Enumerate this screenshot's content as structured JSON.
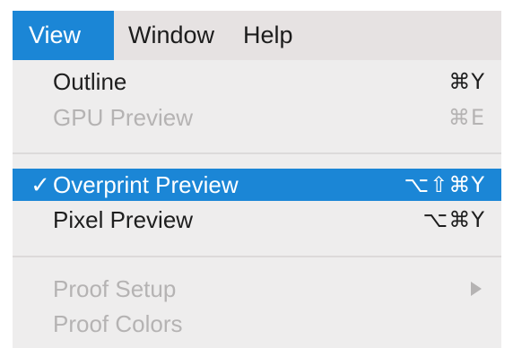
{
  "menubar": {
    "items": [
      {
        "label": "View"
      },
      {
        "label": "Window"
      },
      {
        "label": "Help"
      }
    ]
  },
  "menu": {
    "items": [
      {
        "label": "Outline",
        "shortcut": "⌘Y",
        "enabled": true
      },
      {
        "label": "GPU Preview",
        "shortcut": "⌘E",
        "enabled": false
      },
      {
        "label": "Overprint Preview",
        "shortcut": "⌥⇧⌘Y",
        "enabled": true,
        "checked": true,
        "highlighted": true
      },
      {
        "label": "Pixel Preview",
        "shortcut": "⌥⌘Y",
        "enabled": true
      },
      {
        "label": "Proof Setup",
        "enabled": false,
        "has_submenu": true
      },
      {
        "label": "Proof Colors",
        "enabled": false
      }
    ],
    "check_glyph": "✓"
  },
  "colors": {
    "highlight": "#1b86d6",
    "menu_bg": "#eeeded",
    "menubar_bg": "#e6e2e2",
    "disabled_text": "#b5b3b3"
  },
  "icons": {
    "submenu": "chevron-right-icon",
    "check": "checkmark-icon"
  }
}
